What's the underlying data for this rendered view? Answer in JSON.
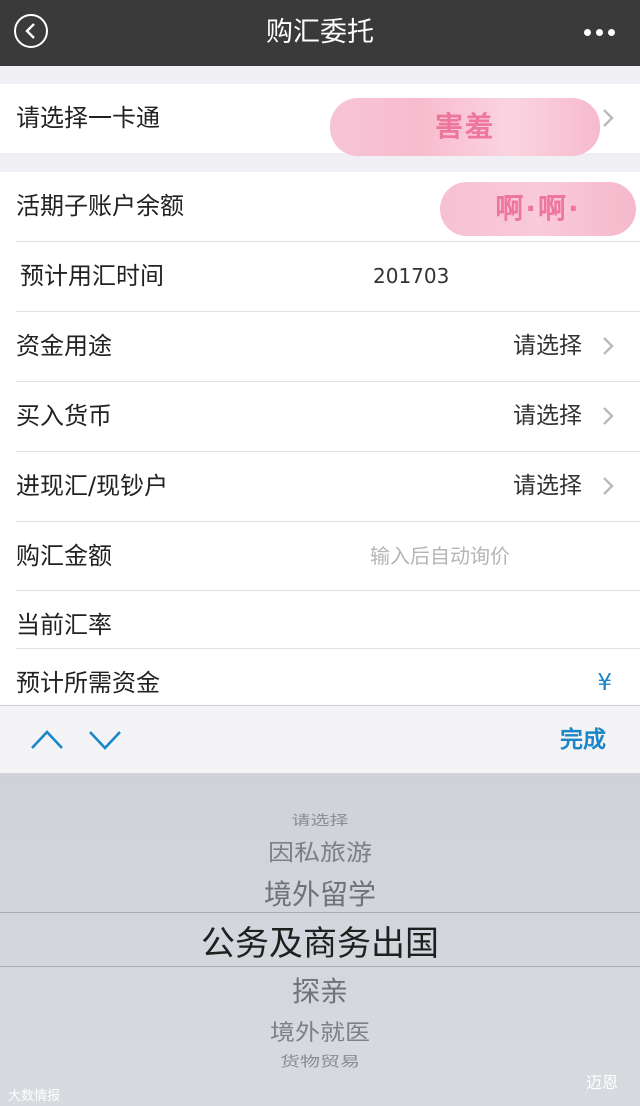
{
  "header": {
    "title": "购汇委托"
  },
  "form": {
    "select_card_label": "请选择一卡通",
    "card_obscured_text": "害羞",
    "balance_label": "活期子账户余额",
    "balance_obscured_text": "啊·啊·",
    "expected_time_label": "预计用汇时间",
    "expected_time_value": "201703",
    "fund_usage_label": "资金用途",
    "fund_usage_value": "请选择",
    "buy_currency_label": "买入货币",
    "buy_currency_value": "请选择",
    "account_type_label": "进现汇/现钞户",
    "account_type_value": "请选择",
    "amount_label": "购汇金额",
    "amount_placeholder": "输入后自动询价",
    "rate_label": "当前汇率",
    "required_funds_label": "预计所需资金",
    "required_funds_value": "¥"
  },
  "toolbar": {
    "done_label": "完成"
  },
  "picker": {
    "options": [
      "请选择",
      "因私旅游",
      "境外留学",
      "公务及商务出国",
      "探亲",
      "境外就医",
      "货物贸易"
    ],
    "selected": "公务及商务出国"
  },
  "watermark": {
    "left": "大数情报",
    "right": "迈恩"
  },
  "colors": {
    "titlebar": "#3a3a3a",
    "accent": "#1a86c9",
    "background": "#efeff4"
  }
}
